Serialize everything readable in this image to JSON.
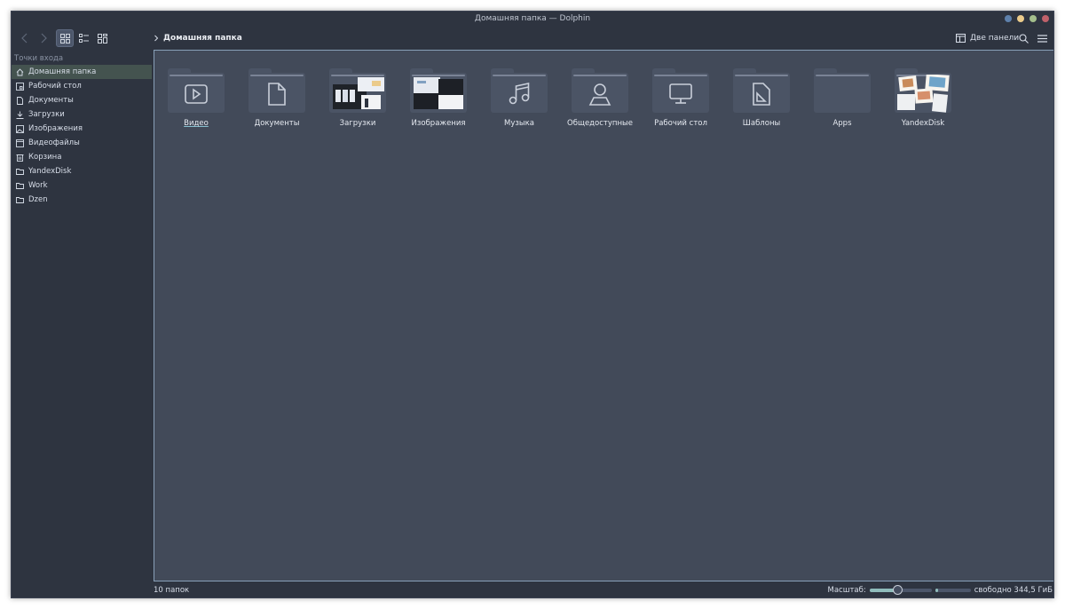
{
  "window": {
    "title": "Домашняя папка — Dolphin",
    "controls": [
      {
        "name": "minimize",
        "color": "#5e81ac"
      },
      {
        "name": "keep-above",
        "color": "#ebcb8b"
      },
      {
        "name": "maximize",
        "color": "#a3be8c"
      },
      {
        "name": "close",
        "color": "#bf616a"
      }
    ]
  },
  "toolbar": {
    "back_icon": "chevron-left-icon",
    "forward_icon": "chevron-right-icon",
    "view_modes": [
      "icons-view-icon",
      "details-view-icon",
      "compact-view-icon"
    ],
    "active_view": "icons",
    "split_label": "Две панели",
    "search_icon": "search-icon",
    "menu_icon": "hamburger-icon"
  },
  "breadcrumb": {
    "current": "Домашняя папка"
  },
  "sidebar": {
    "section_title": "Точки входа",
    "items": [
      {
        "label": "Домашняя папка",
        "icon": "home-icon",
        "selected": true
      },
      {
        "label": "Рабочий стол",
        "icon": "desktop-icon"
      },
      {
        "label": "Документы",
        "icon": "document-icon"
      },
      {
        "label": "Загрузки",
        "icon": "download-icon"
      },
      {
        "label": "Изображения",
        "icon": "image-icon"
      },
      {
        "label": "Видеофайлы",
        "icon": "video-icon"
      },
      {
        "label": "Корзина",
        "icon": "trash-icon"
      },
      {
        "label": "YandexDisk",
        "icon": "folder-icon"
      },
      {
        "label": "Work",
        "icon": "folder-icon"
      },
      {
        "label": "Dzen",
        "icon": "folder-icon"
      }
    ]
  },
  "folders": [
    {
      "label": "Видео",
      "icon": "video-play-icon",
      "current": true
    },
    {
      "label": "Документы",
      "icon": "document-icon"
    },
    {
      "label": "Загрузки",
      "icon": "thumbnails-icon"
    },
    {
      "label": "Изображения",
      "icon": "thumbnails-icon"
    },
    {
      "label": "Музыка",
      "icon": "music-note-icon"
    },
    {
      "label": "Общедоступные",
      "icon": "user-icon"
    },
    {
      "label": "Рабочий стол",
      "icon": "monitor-icon"
    },
    {
      "label": "Шаблоны",
      "icon": "template-icon"
    },
    {
      "label": "Apps",
      "icon": "folder-icon"
    },
    {
      "label": "YandexDisk",
      "icon": "thumbnails-icon"
    }
  ],
  "status": {
    "count": "10 папок",
    "zoom_label": "Масштаб:",
    "zoom_level": 0.45,
    "free_space": "свободно 344,5 ГиБ",
    "used_fraction": 0.08
  },
  "colors": {
    "window_bg": "#2e3440",
    "view_bg": "#424a59",
    "accent": "#88c0d0",
    "selection": "#44534f"
  }
}
